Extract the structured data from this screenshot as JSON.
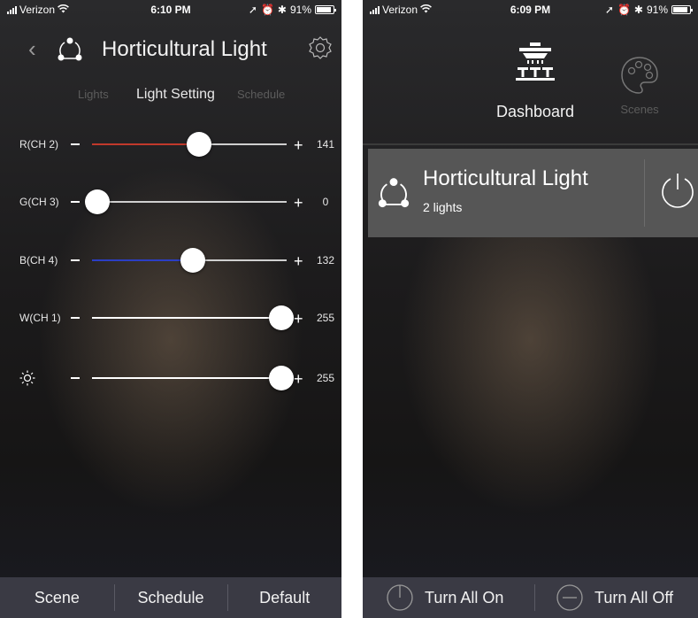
{
  "left_screen": {
    "status": {
      "carrier": "Verizon",
      "time": "6:10 PM",
      "battery": "91%"
    },
    "header": {
      "title": "Horticultural Light",
      "back_icon": "chevron-left-icon",
      "settings_icon": "gear-icon"
    },
    "subtabs": [
      {
        "label": "Lights",
        "active": false
      },
      {
        "label": "Light Setting",
        "active": true
      },
      {
        "label": "Schedule",
        "active": false
      }
    ],
    "sliders": [
      {
        "label": "R(CH 2)",
        "value": 141,
        "max": 255,
        "fill_color": "#c0392b",
        "minus": "−",
        "plus": "+"
      },
      {
        "label": "G(CH 3)",
        "value": 0,
        "max": 255,
        "fill_color": "#cfcfcf",
        "minus": "−",
        "plus": "+"
      },
      {
        "label": "B(CH 4)",
        "value": 132,
        "max": 255,
        "fill_color": "#2b3ec4",
        "minus": "−",
        "plus": "+"
      },
      {
        "label": "W(CH 1)",
        "value": 255,
        "max": 255,
        "fill_color": "#ffffff",
        "minus": "−",
        "plus": "+"
      },
      {
        "label": "",
        "icon": "brightness-icon",
        "value": 255,
        "max": 255,
        "fill_color": "#ffffff",
        "minus": "−",
        "plus": "+"
      }
    ],
    "bottom_bar": [
      "Scene",
      "Schedule",
      "Default"
    ]
  },
  "right_screen": {
    "status": {
      "carrier": "Verizon",
      "time": "6:09 PM",
      "battery": "91%"
    },
    "tabs": [
      {
        "label": "Dashboard",
        "icon": "dashboard-icon",
        "active": true
      },
      {
        "label": "Scenes",
        "icon": "palette-icon",
        "active": false
      }
    ],
    "group": {
      "name": "Horticultural Light",
      "count": "2 lights",
      "icon": "group-icon",
      "power_icon": "power-icon"
    },
    "bottom_bar": [
      {
        "label": "Turn All On",
        "icon": "power-on-icon"
      },
      {
        "label": "Turn All Off",
        "icon": "power-off-icon"
      }
    ]
  }
}
